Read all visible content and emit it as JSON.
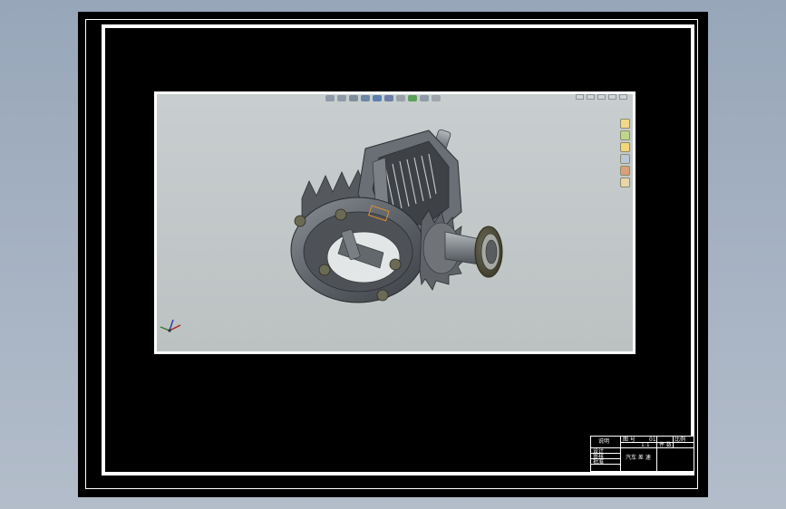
{
  "drawing": {
    "title_block": {
      "name_label": "说明",
      "sheet_label": "图 号",
      "sheet_no": "01",
      "ratio_label": "比例",
      "scale_label": "1:1",
      "qty_label": "件 数",
      "row_labels": [
        "设计",
        "审核",
        "批准"
      ],
      "company": "汽车 差 速"
    }
  },
  "viewer": {
    "toolbar_icons": [
      "zoom-icon",
      "zoom-area-icon",
      "rotate-icon",
      "section-icon",
      "display-style-icon",
      "view-orientation-icon",
      "hide-show-icon",
      "appearance-icon",
      "scene-icon",
      "settings-icon"
    ],
    "side_panel_icons": [
      "home-view-icon",
      "design-library-icon",
      "file-explorer-icon",
      "view-palette-icon",
      "appearance-panel-icon",
      "custom-properties-icon"
    ],
    "model_name": "differential-gear-assembly"
  },
  "colors": {
    "desktop": "#a3b0c1",
    "sheet": "#000000",
    "border": "#ffffff",
    "viewport_bg": "#c2c8c8",
    "part_dark": "#5a5e63",
    "part_mid": "#787d83",
    "selection": "#e0902a"
  }
}
